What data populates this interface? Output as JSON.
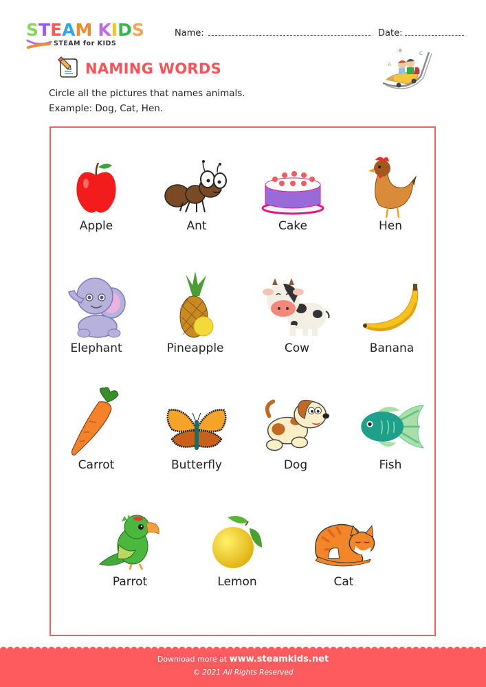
{
  "header": {
    "logo": {
      "letters": [
        {
          "char": "S",
          "color": "#8cd35a"
        },
        {
          "char": "T",
          "color": "#9b59e8"
        },
        {
          "char": "E",
          "color": "#f25a5e"
        },
        {
          "char": "A",
          "color": "#2fa8e8"
        },
        {
          "char": "M",
          "color": "#f08a33"
        },
        {
          "char": " ",
          "color": "#ffffff"
        },
        {
          "char": "K",
          "color": "#c06ae0"
        },
        {
          "char": "I",
          "color": "#f2c230"
        },
        {
          "char": "D",
          "color": "#35b84a"
        },
        {
          "char": "S",
          "color": "#f4a55a"
        }
      ],
      "subtitle": "STEAM for KIDS"
    },
    "name_label": "Name:",
    "date_label": "Date:"
  },
  "worksheet": {
    "title": "NAMING WORDS",
    "title_icon": "pencil-paper-icon",
    "instruction_line1": "Circle all the pictures that names animals.",
    "instruction_line2": "Example: Dog, Cat, Hen.",
    "accent_color": "#f4545a"
  },
  "items": [
    {
      "label": "Apple",
      "icon": "apple-icon"
    },
    {
      "label": "Ant",
      "icon": "ant-icon"
    },
    {
      "label": "Cake",
      "icon": "cake-icon"
    },
    {
      "label": "Hen",
      "icon": "hen-icon"
    },
    {
      "label": "Elephant",
      "icon": "elephant-icon"
    },
    {
      "label": "Pineapple",
      "icon": "pineapple-icon"
    },
    {
      "label": "Cow",
      "icon": "cow-icon"
    },
    {
      "label": "Banana",
      "icon": "banana-icon"
    },
    {
      "label": "Carrot",
      "icon": "carrot-icon"
    },
    {
      "label": "Butterfly",
      "icon": "butterfly-icon"
    },
    {
      "label": "Dog",
      "icon": "dog-icon"
    },
    {
      "label": "Fish",
      "icon": "fish-icon"
    },
    {
      "label": "Parrot",
      "icon": "parrot-icon"
    },
    {
      "label": "Lemon",
      "icon": "lemon-icon"
    },
    {
      "label": "Cat",
      "icon": "cat-icon"
    }
  ],
  "footer": {
    "download_text": "Download more at",
    "url": "www.steamkids.net",
    "copyright": "© 2021 All Rights Reserved",
    "background_color": "#fd5b5d"
  }
}
